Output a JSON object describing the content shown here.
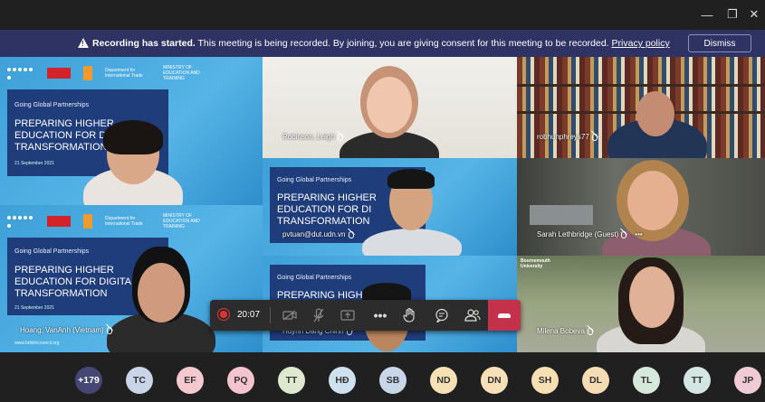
{
  "window": {
    "minimize": "—",
    "restore": "❐",
    "close": "✕"
  },
  "banner": {
    "title": "Recording has started.",
    "message": "This meeting is being recorded. By joining, you are giving consent for this meeting to be recorded.",
    "link": "Privacy policy",
    "dismiss": "Dismiss"
  },
  "slide": {
    "brand": "BRITISH COUNCIL",
    "partner": "Department for International Trade",
    "ministry": "MINISTRY OF EDUCATION AND TRAINING",
    "subtitle": "Going Global Partnerships",
    "title_line1": "PREPARING HIGHER",
    "title_line2": "EDUCATION FOR DIGI",
    "title_line3": "TRANSFORMATION",
    "date": "21 September 2021",
    "url": "www.britishcouncil.org"
  },
  "participants": [
    {
      "name": "Robinson, Leigh"
    },
    {
      "name": "robhunphreys77"
    },
    {
      "name": "pvtuan@dut.udn.vn"
    },
    {
      "name": "Sarah Lethbridge (Guest)"
    },
    {
      "name": "Hoang, VanAnh (Vietnam)"
    },
    {
      "name": "Huynh Dang Chinh"
    },
    {
      "name": "Milena Bobeva"
    }
  ],
  "slide2": {
    "title_line2": "EDUCATION FOR DIGITA",
    "title_line2b": "EDUCATION FOR DI"
  },
  "institution": "Bournemouth University",
  "controls": {
    "timer": "20:07"
  },
  "more_count": "+179",
  "avatars": [
    {
      "initials": "TC",
      "color": "#c9d4e6"
    },
    {
      "initials": "EF",
      "color": "#f3c9cf"
    },
    {
      "initials": "PQ",
      "color": "#f2c4cf"
    },
    {
      "initials": "TT",
      "color": "#dfe8cf"
    },
    {
      "initials": "HĐ",
      "color": "#cfe0ee"
    },
    {
      "initials": "SB",
      "color": "#c9d6ea"
    },
    {
      "initials": "ND",
      "color": "#f6e1b5"
    },
    {
      "initials": "DN",
      "color": "#f7e0b8"
    },
    {
      "initials": "SH",
      "color": "#f6dfb3"
    },
    {
      "initials": "DL",
      "color": "#f6dcb2"
    },
    {
      "initials": "TL",
      "color": "#d6e8da"
    },
    {
      "initials": "TT",
      "color": "#d3e6e2"
    },
    {
      "initials": "JP",
      "color": "#f0cbd6"
    }
  ],
  "colors": {
    "banner": "#2e3364",
    "hangup": "#c4314b",
    "more": "#464775"
  }
}
